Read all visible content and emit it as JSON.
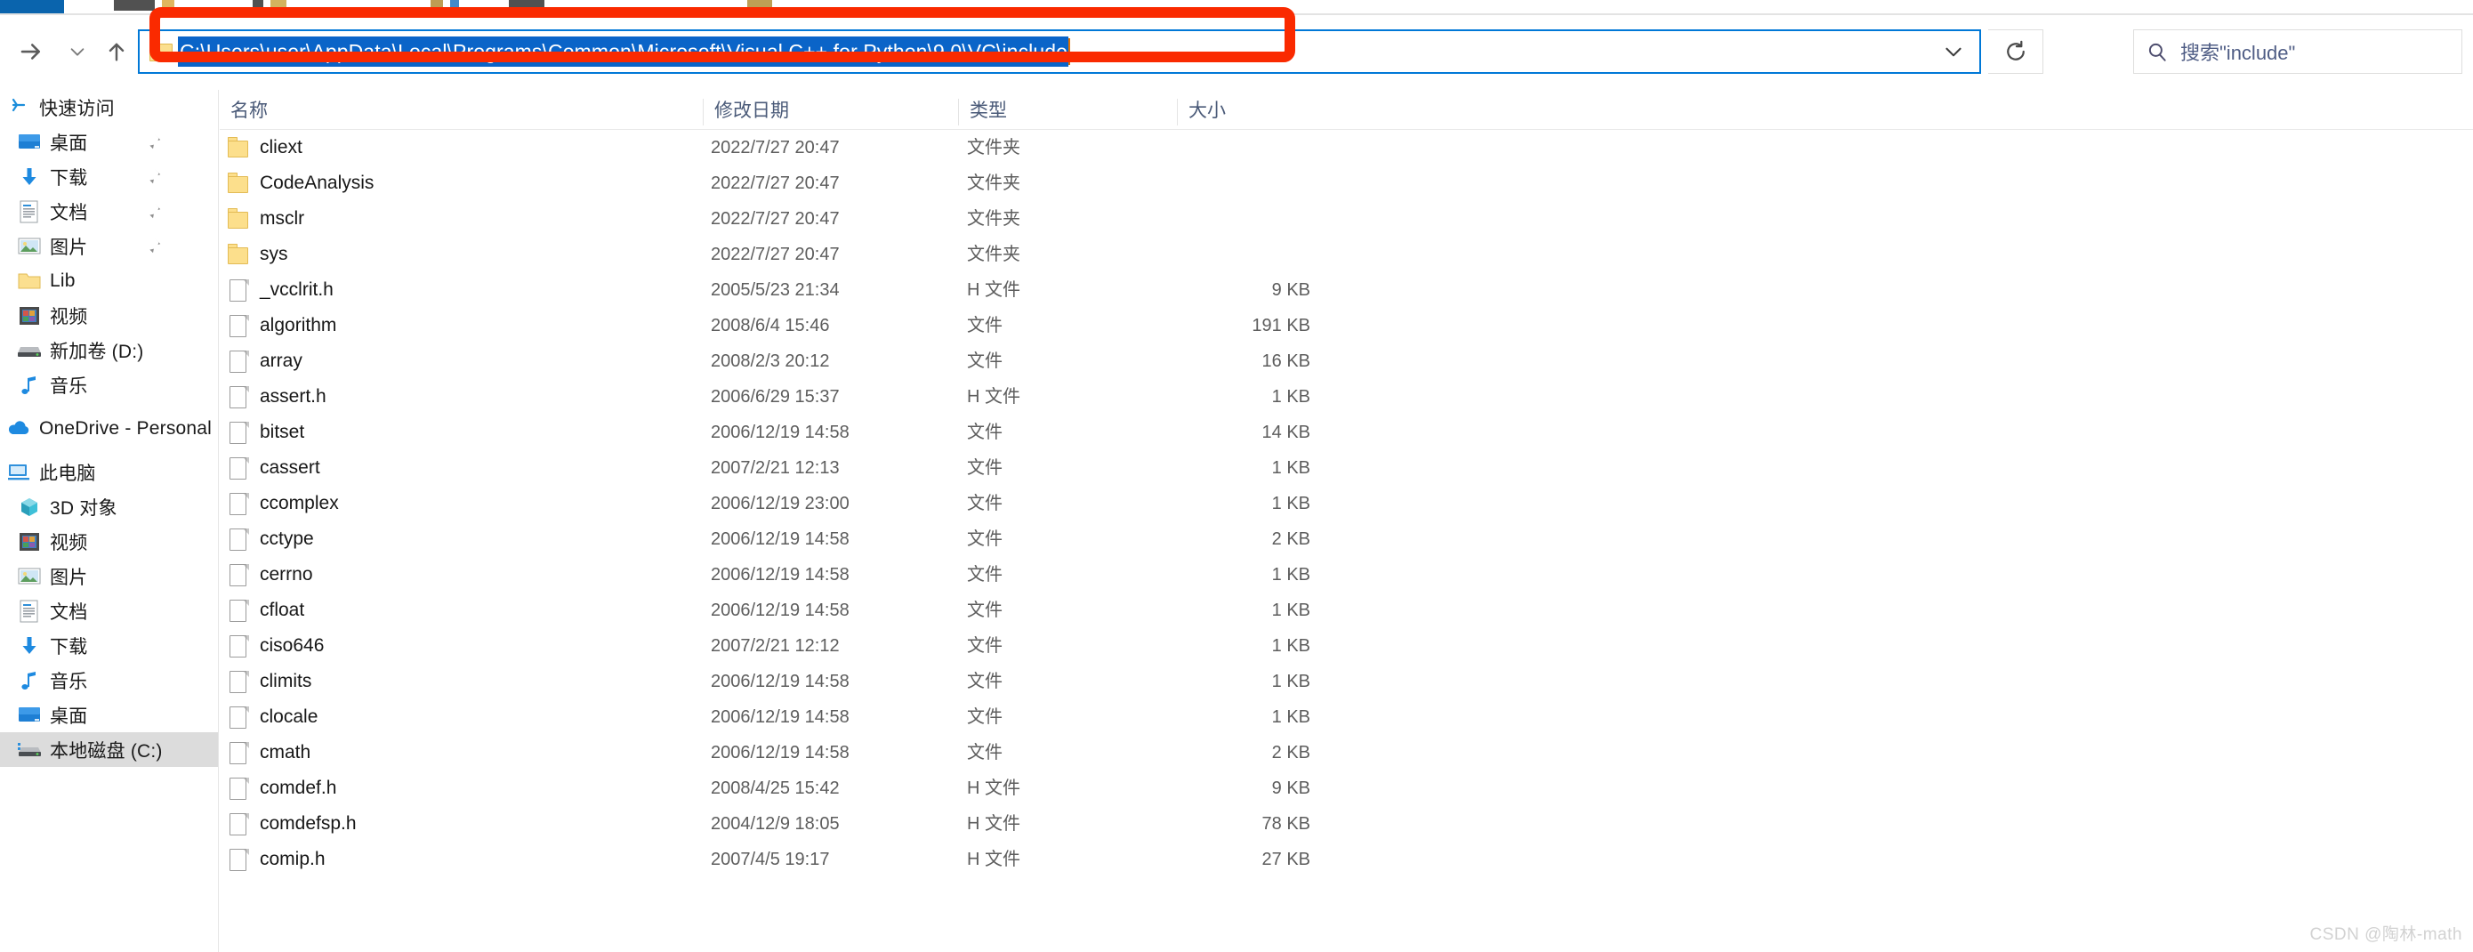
{
  "window": {
    "watermark": "CSDN @陶林-math"
  },
  "nav": {
    "forward_label": "前进",
    "recent_label": "最近使用的位置",
    "up_label": "上移一级",
    "refresh_label": "刷新",
    "forward_icon": "arrow-right-icon",
    "recent_icon": "chevron-down-icon",
    "up_icon": "arrow-up-icon",
    "refresh_icon": "refresh-icon"
  },
  "address": {
    "path": "C:\\Users\\user\\AppData\\Local\\Programs\\Common\\Microsoft\\Visual C++ for Python\\9.0\\VC\\include",
    "folder_icon": "folder-icon",
    "dropdown_icon": "chevron-down-icon",
    "selected": true
  },
  "search": {
    "placeholder": "搜索\"include\"",
    "value": "",
    "icon": "search-icon"
  },
  "annotation": {
    "color": "#fa2a00",
    "target": "address-bar"
  },
  "sidebar": {
    "groups": [
      {
        "name": "quick-access",
        "header": {
          "label": "快速访问",
          "icon": "star-pin-icon"
        },
        "items": [
          {
            "label": "桌面",
            "icon": "desktop-icon",
            "pinned": true
          },
          {
            "label": "下载",
            "icon": "download-icon",
            "pinned": true
          },
          {
            "label": "文档",
            "icon": "document-icon",
            "pinned": true
          },
          {
            "label": "图片",
            "icon": "pictures-icon",
            "pinned": true
          },
          {
            "label": "Lib",
            "icon": "folder-icon",
            "pinned": false
          },
          {
            "label": "视频",
            "icon": "video-icon",
            "pinned": false
          },
          {
            "label": "新加卷 (D:)",
            "icon": "drive-icon",
            "pinned": false
          },
          {
            "label": "音乐",
            "icon": "music-icon",
            "pinned": false
          }
        ]
      },
      {
        "name": "onedrive",
        "header": {
          "label": "OneDrive - Personal",
          "icon": "onedrive-icon"
        },
        "items": []
      },
      {
        "name": "this-pc",
        "header": {
          "label": "此电脑",
          "icon": "computer-icon"
        },
        "items": [
          {
            "label": "3D 对象",
            "icon": "3d-objects-icon",
            "pinned": false
          },
          {
            "label": "视频",
            "icon": "video-icon",
            "pinned": false
          },
          {
            "label": "图片",
            "icon": "pictures-icon",
            "pinned": false
          },
          {
            "label": "文档",
            "icon": "document-icon",
            "pinned": false
          },
          {
            "label": "下载",
            "icon": "download-icon",
            "pinned": false
          },
          {
            "label": "音乐",
            "icon": "music-icon",
            "pinned": false
          },
          {
            "label": "桌面",
            "icon": "desktop-icon",
            "pinned": false
          },
          {
            "label": "本地磁盘 (C:)",
            "icon": "drive-icon",
            "pinned": false,
            "selected": true
          }
        ]
      }
    ]
  },
  "filelist": {
    "columns": [
      {
        "key": "name",
        "label": "名称"
      },
      {
        "key": "date",
        "label": "修改日期"
      },
      {
        "key": "type",
        "label": "类型"
      },
      {
        "key": "size",
        "label": "大小"
      }
    ],
    "rows": [
      {
        "name": "cliext",
        "date": "2022/7/27 20:47",
        "type": "文件夹",
        "size": "",
        "icon": "folder-icon"
      },
      {
        "name": "CodeAnalysis",
        "date": "2022/7/27 20:47",
        "type": "文件夹",
        "size": "",
        "icon": "folder-icon"
      },
      {
        "name": "msclr",
        "date": "2022/7/27 20:47",
        "type": "文件夹",
        "size": "",
        "icon": "folder-icon"
      },
      {
        "name": "sys",
        "date": "2022/7/27 20:47",
        "type": "文件夹",
        "size": "",
        "icon": "folder-icon"
      },
      {
        "name": "_vcclrit.h",
        "date": "2005/5/23 21:34",
        "type": "H 文件",
        "size": "9 KB",
        "icon": "file-icon"
      },
      {
        "name": "algorithm",
        "date": "2008/6/4 15:46",
        "type": "文件",
        "size": "191 KB",
        "icon": "file-icon"
      },
      {
        "name": "array",
        "date": "2008/2/3 20:12",
        "type": "文件",
        "size": "16 KB",
        "icon": "file-icon"
      },
      {
        "name": "assert.h",
        "date": "2006/6/29 15:37",
        "type": "H 文件",
        "size": "1 KB",
        "icon": "file-icon"
      },
      {
        "name": "bitset",
        "date": "2006/12/19 14:58",
        "type": "文件",
        "size": "14 KB",
        "icon": "file-icon"
      },
      {
        "name": "cassert",
        "date": "2007/2/21 12:13",
        "type": "文件",
        "size": "1 KB",
        "icon": "file-icon"
      },
      {
        "name": "ccomplex",
        "date": "2006/12/19 23:00",
        "type": "文件",
        "size": "1 KB",
        "icon": "file-icon"
      },
      {
        "name": "cctype",
        "date": "2006/12/19 14:58",
        "type": "文件",
        "size": "2 KB",
        "icon": "file-icon"
      },
      {
        "name": "cerrno",
        "date": "2006/12/19 14:58",
        "type": "文件",
        "size": "1 KB",
        "icon": "file-icon"
      },
      {
        "name": "cfloat",
        "date": "2006/12/19 14:58",
        "type": "文件",
        "size": "1 KB",
        "icon": "file-icon"
      },
      {
        "name": "ciso646",
        "date": "2007/2/21 12:12",
        "type": "文件",
        "size": "1 KB",
        "icon": "file-icon"
      },
      {
        "name": "climits",
        "date": "2006/12/19 14:58",
        "type": "文件",
        "size": "1 KB",
        "icon": "file-icon"
      },
      {
        "name": "clocale",
        "date": "2006/12/19 14:58",
        "type": "文件",
        "size": "1 KB",
        "icon": "file-icon"
      },
      {
        "name": "cmath",
        "date": "2006/12/19 14:58",
        "type": "文件",
        "size": "2 KB",
        "icon": "file-icon"
      },
      {
        "name": "comdef.h",
        "date": "2008/4/25 15:42",
        "type": "H 文件",
        "size": "9 KB",
        "icon": "file-icon"
      },
      {
        "name": "comdefsp.h",
        "date": "2004/12/9 18:05",
        "type": "H 文件",
        "size": "78 KB",
        "icon": "file-icon"
      },
      {
        "name": "comip.h",
        "date": "2007/4/5 19:17",
        "type": "H 文件",
        "size": "27 KB",
        "icon": "file-icon"
      }
    ]
  }
}
